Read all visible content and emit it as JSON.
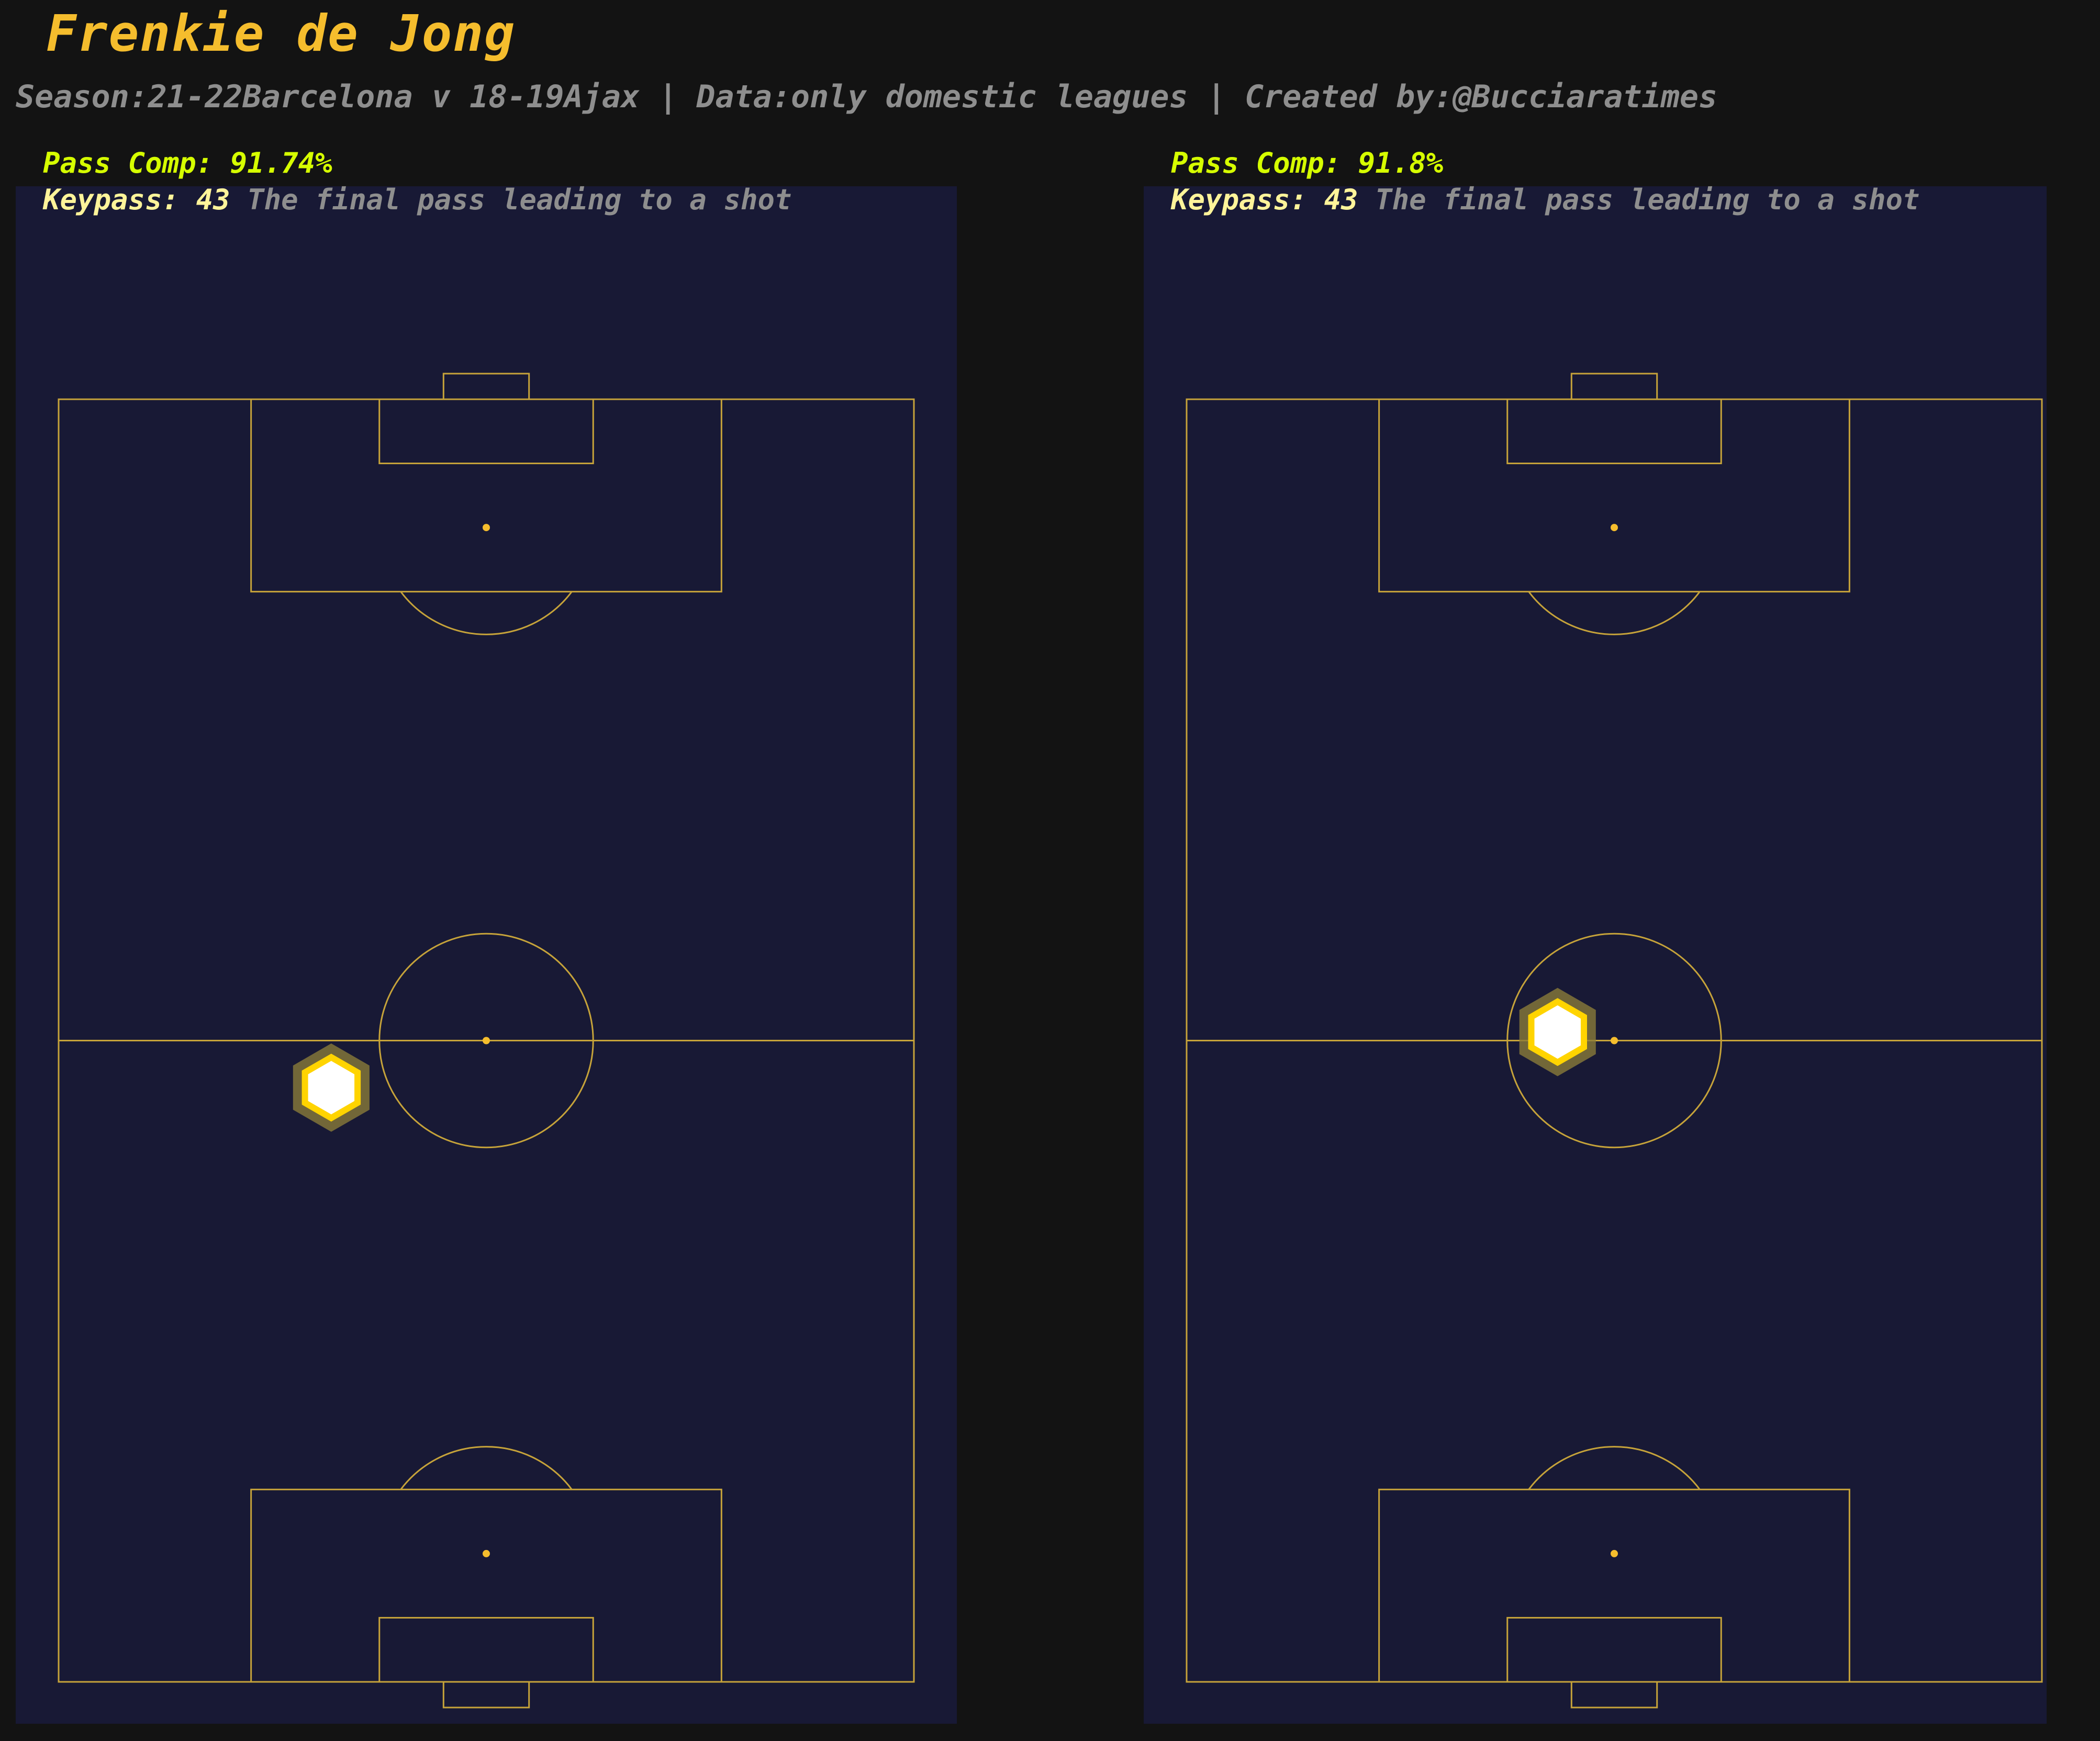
{
  "title": "Frenkie de Jong",
  "subtitle": "Season:21-22Barcelona v 18-19Ajax | Data:only domestic leagues | Created by:@Bucciaratimes",
  "colors": {
    "background": "#131313",
    "pitch": "#181935",
    "lines": "#c6a33a",
    "title": "#f5bd2d",
    "pass_comp": "#d6ff00",
    "keypass": "#fff49a",
    "muted": "#8e8e8e",
    "marker_fill": "#ffffff",
    "marker_edge": "#ffd400"
  },
  "panels": [
    {
      "pass_comp_label": "Pass Comp: 91.74%",
      "keypass_label": "Keypass: 43",
      "keypass_desc": "The final pass leading to a shot"
    },
    {
      "pass_comp_label": "Pass Comp: 91.8%",
      "keypass_label": "Keypass: 43",
      "keypass_desc": "The final pass leading to a shot"
    }
  ],
  "chart_data": [
    {
      "type": "scatter",
      "marker": "hexagon",
      "pitch_length": 120,
      "pitch_width": 80,
      "series": [
        {
          "x": 55.6,
          "y": 25.5
        }
      ]
    },
    {
      "type": "scatter",
      "marker": "hexagon",
      "pitch_length": 120,
      "pitch_width": 80,
      "series": [
        {
          "x": 60.8,
          "y": 34.7
        }
      ]
    }
  ]
}
